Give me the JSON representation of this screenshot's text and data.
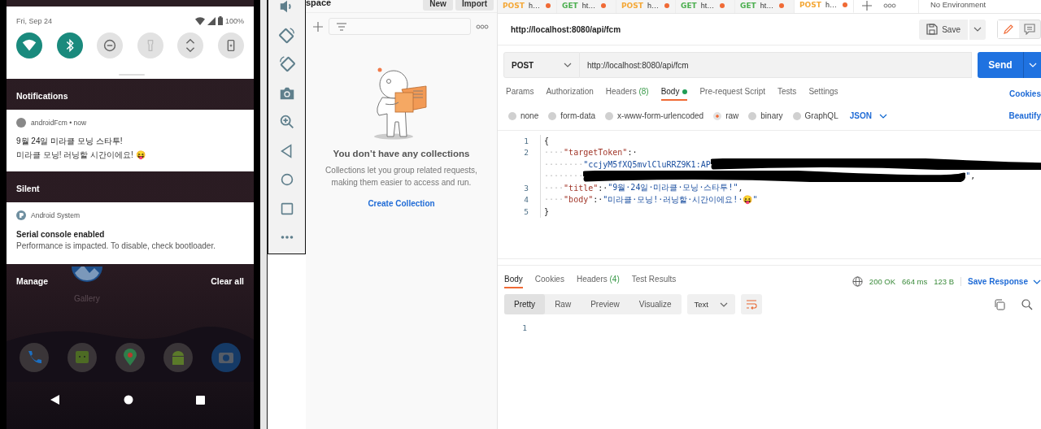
{
  "phone": {
    "date": "Fri, Sep 24",
    "battery": "100%",
    "quick_tiles": [
      {
        "kind": "wifi",
        "on": true
      },
      {
        "kind": "bluetooth",
        "on": true
      },
      {
        "kind": "dnd",
        "on": false
      },
      {
        "kind": "flashlight",
        "on": false
      },
      {
        "kind": "rotate",
        "on": false
      },
      {
        "kind": "battery",
        "on": false
      }
    ],
    "notifications_header": "Notifications",
    "notifications": [
      {
        "kind": "dot",
        "app_line": "androidFcm • now",
        "title": "9월 24일 미라클 모닝 스타투!",
        "text": "미라클 모닝! 러닝할 시간이에요! 😝"
      }
    ],
    "silent_header": "Silent",
    "silent": [
      {
        "kind": "system",
        "app_line": "Android System",
        "title": "Serial console enabled",
        "text": "Performance is impacted. To disable, check bootloader."
      }
    ],
    "home_label": "Gallery",
    "manage": "Manage",
    "clear_all": "Clear all"
  },
  "sidebar": {
    "workspace": "space",
    "buttons": [
      "New",
      "Import"
    ],
    "empty_title": "You don’t have any collections",
    "empty_text": "Collections let you group related requests, making them easier to access and run.",
    "empty_link": "Create Collection"
  },
  "tabs": [
    {
      "method": "POST",
      "color": "#f4a838",
      "label": "h…",
      "selected": false
    },
    {
      "method": "GET",
      "color": "#4caf50",
      "label": "ht…",
      "selected": false
    },
    {
      "method": "POST",
      "color": "#f4a838",
      "label": "h…",
      "selected": false
    },
    {
      "method": "GET",
      "color": "#4caf50",
      "label": "ht…",
      "selected": false
    },
    {
      "method": "GET",
      "color": "#4caf50",
      "label": "ht…",
      "selected": false
    },
    {
      "method": "POST",
      "color": "#f4a838",
      "label": "h…",
      "selected": true
    }
  ],
  "environment": "No Environment",
  "request": {
    "title": "http://localhost:8080/api/fcm",
    "save": "Save",
    "method": "POST",
    "url": "http://localhost:8080/api/fcm",
    "send": "Send",
    "tabs": [
      {
        "label": "Params",
        "selected": false
      },
      {
        "label": "Authorization",
        "selected": false
      },
      {
        "label": "Headers",
        "count": "(8)",
        "selected": false
      },
      {
        "label": "Body",
        "dot": true,
        "selected": true
      },
      {
        "label": "Pre-request Script",
        "selected": false
      },
      {
        "label": "Tests",
        "selected": false
      },
      {
        "label": "Settings",
        "selected": false
      }
    ],
    "cookies": "Cookies",
    "body_types": [
      {
        "label": "none",
        "selected": false
      },
      {
        "label": "form-data",
        "selected": false
      },
      {
        "label": "x-www-form-urlencoded",
        "selected": false
      },
      {
        "label": "raw",
        "selected": true
      },
      {
        "label": "binary",
        "selected": false
      },
      {
        "label": "GraphQL",
        "selected": false
      }
    ],
    "modes": [
      {
        "kind": "edit",
        "selected": true
      },
      {
        "kind": "comments",
        "selected": false
      }
    ],
    "format": "JSON",
    "beautify": "Beautify",
    "lines": [
      {
        "number": "1",
        "rows": [
          {
            "tokens": [
              {
                "kind": "punct",
                "text": "{"
              }
            ]
          }
        ]
      },
      {
        "number": "2",
        "rows": [
          {
            "tokens": [
              {
                "kind": "space",
                "text": "····"
              },
              {
                "kind": "key",
                "text": "\"targetToken\""
              },
              {
                "kind": "punct",
                "text": ":·"
              }
            ]
          },
          {
            "tokens": [
              {
                "kind": "space",
                "text": "········"
              },
              {
                "kind": "string",
                "text": "\"ccjyM5fXQ5mvlCluRRZ9K1:AP"
              },
              {
                "kind": "redacted"
              }
            ]
          },
          {
            "tokens": [
              {
                "kind": "space",
                "text": "········"
              },
              {
                "kind": "redacted"
              },
              {
                "kind": "string",
                "text": "\""
              },
              {
                "kind": "punct",
                "text": ","
              }
            ]
          }
        ]
      },
      {
        "number": "3",
        "rows": [
          {
            "tokens": [
              {
                "kind": "space",
                "text": "····"
              },
              {
                "kind": "key",
                "text": "\"title\""
              },
              {
                "kind": "punct",
                "text": ":·"
              },
              {
                "kind": "string",
                "text": "\"9월·24일·미라클·모닝·스타투!\""
              },
              {
                "kind": "punct",
                "text": ","
              }
            ]
          }
        ]
      },
      {
        "number": "4",
        "rows": [
          {
            "tokens": [
              {
                "kind": "space",
                "text": "····"
              },
              {
                "kind": "key",
                "text": "\"body\""
              },
              {
                "kind": "punct",
                "text": ":·"
              },
              {
                "kind": "string",
                "text": "\"미라클·모닝!·러닝할·시간이에요!·😝\""
              }
            ]
          }
        ]
      },
      {
        "number": "5",
        "rows": [
          {
            "tokens": [
              {
                "kind": "punct",
                "text": "}"
              }
            ]
          }
        ]
      }
    ]
  },
  "response": {
    "tabs": [
      {
        "label": "Body",
        "selected": true
      },
      {
        "label": "Cookies",
        "selected": false
      },
      {
        "label": "Headers",
        "count": "(4)",
        "selected": false
      },
      {
        "label": "Test Results",
        "selected": false
      }
    ],
    "status": "200 OK",
    "time": "664 ms",
    "size": "123 B",
    "save": "Save Response",
    "views": [
      {
        "label": "Pretty",
        "selected": true
      },
      {
        "label": "Raw",
        "selected": false
      },
      {
        "label": "Preview",
        "selected": false
      },
      {
        "label": "Visualize",
        "selected": false
      }
    ],
    "format": "Text",
    "line_numbers": [
      "1"
    ]
  }
}
